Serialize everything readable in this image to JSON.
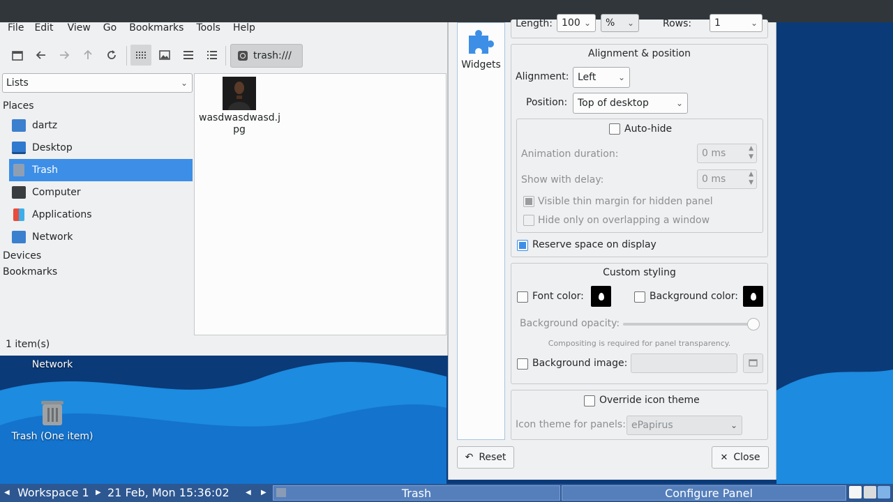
{
  "file_manager": {
    "menu": [
      "File",
      "Edit",
      "View",
      "Go",
      "Bookmarks",
      "Tools",
      "Help"
    ],
    "address": "trash:///",
    "side_pane_mode": "Lists",
    "places_heading": "Places",
    "places": [
      "dartz",
      "Desktop",
      "Trash",
      "Computer",
      "Applications",
      "Network"
    ],
    "selected_place": "Trash",
    "devices_heading": "Devices",
    "bookmarks_heading": "Bookmarks",
    "files": [
      {
        "name_line1": "wasdwasdwasd.j",
        "name_line2": "pg"
      }
    ],
    "status": "1 item(s)"
  },
  "desktop": {
    "network_label": "Network",
    "trash_label": "Trash (One item)"
  },
  "configure_panel": {
    "sidebar_label": "Widgets",
    "top_row": {
      "length_label": "Length:",
      "length_value": "100",
      "unit_value": "%",
      "rows_label": "Rows:",
      "rows_value": "1"
    },
    "alignment_group": {
      "title": "Alignment & position",
      "alignment_label": "Alignment:",
      "alignment_value": "Left",
      "position_label": "Position:",
      "position_value": "Top of desktop",
      "autohide_label": "Auto-hide",
      "animation_label": "Animation duration:",
      "animation_value": "0 ms",
      "delay_label": "Show with delay:",
      "delay_value": "0 ms",
      "thin_margin_label": "Visible thin margin for hidden panel",
      "overlap_label": "Hide only on overlapping a window",
      "reserve_label": "Reserve space on display"
    },
    "styling_group": {
      "title": "Custom styling",
      "font_color_label": "Font color:",
      "bg_color_label": "Background color:",
      "opacity_label": "Background opacity:",
      "opacity_value": 1.0,
      "compositing_note": "Compositing is required for panel transparency.",
      "bg_image_label": "Background image:"
    },
    "icon_group": {
      "override_label": "Override icon theme",
      "theme_label": "Icon theme for panels:",
      "theme_value": "ePapirus"
    },
    "reset_label": "Reset",
    "close_label": "Close"
  },
  "taskbar": {
    "workspace": "Workspace 1",
    "clock": "21 Feb, Mon 15:36:02",
    "tasks": [
      "Trash",
      "Configure Panel"
    ]
  },
  "colors": {
    "accent": "#3d8ee6",
    "taskbar": "#2d5791",
    "window_bg": "#eff0f1"
  }
}
